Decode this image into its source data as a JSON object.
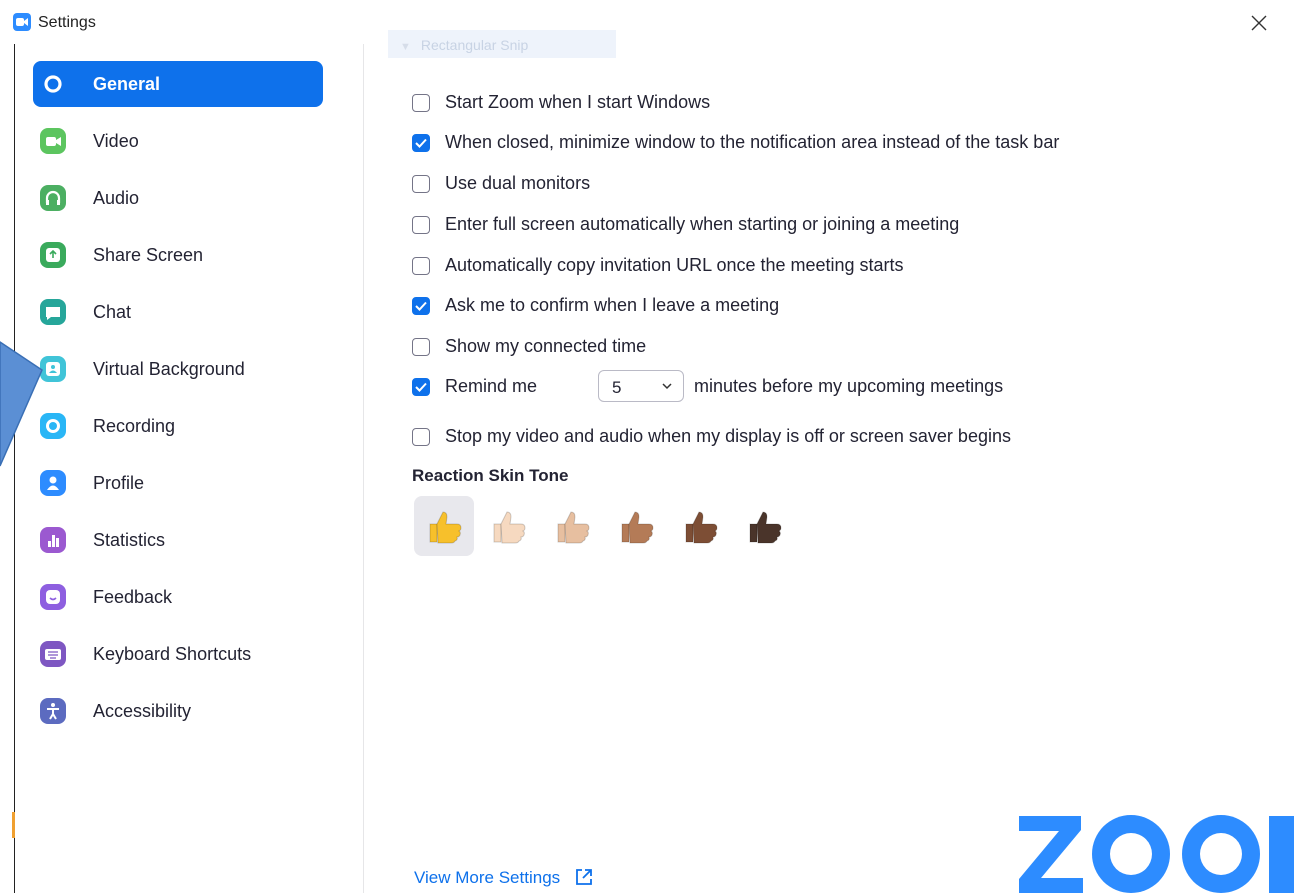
{
  "window": {
    "title": "Settings"
  },
  "overlay": {
    "snip_label": "Rectangular Snip"
  },
  "sidebar": {
    "items": [
      {
        "label": "General",
        "icon": "gear-icon",
        "color": "#0e71eb",
        "active": true
      },
      {
        "label": "Video",
        "icon": "video-camera-icon",
        "color": "#5cc55f"
      },
      {
        "label": "Audio",
        "icon": "headphones-icon",
        "color": "#4caf62"
      },
      {
        "label": "Share Screen",
        "icon": "share-screen-icon",
        "color": "#3aaa5c"
      },
      {
        "label": "Chat",
        "icon": "chat-bubble-icon",
        "color": "#26a69a"
      },
      {
        "label": "Virtual Background",
        "icon": "virtual-background-icon",
        "color": "#40c4d8"
      },
      {
        "label": "Recording",
        "icon": "record-icon",
        "color": "#29b6f6"
      },
      {
        "label": "Profile",
        "icon": "profile-icon",
        "color": "#2d8cff"
      },
      {
        "label": "Statistics",
        "icon": "statistics-icon",
        "color": "#9b59d0"
      },
      {
        "label": "Feedback",
        "icon": "smiley-icon",
        "color": "#8e5fe0"
      },
      {
        "label": "Keyboard Shortcuts",
        "icon": "keyboard-icon",
        "color": "#7e57c2"
      },
      {
        "label": "Accessibility",
        "icon": "accessibility-icon",
        "color": "#5c6bc0"
      }
    ]
  },
  "general": {
    "options": [
      {
        "label": "Start Zoom when I start Windows",
        "checked": false
      },
      {
        "label": "When closed, minimize window to the notification area instead of the task bar",
        "checked": true
      },
      {
        "label": "Use dual monitors",
        "checked": false
      },
      {
        "label": "Enter full screen automatically when starting or joining a meeting",
        "checked": false
      },
      {
        "label": "Automatically copy invitation URL once the meeting starts",
        "checked": false
      },
      {
        "label": "Ask me to confirm when I leave a meeting",
        "checked": true
      },
      {
        "label": "Show my connected time",
        "checked": false
      },
      {
        "label": "Remind me",
        "checked": true,
        "select_value": "5",
        "suffix": "minutes before my upcoming meetings"
      },
      {
        "label": "Stop my video and audio when my display is off or screen saver begins",
        "checked": false
      }
    ],
    "reaction_skin_tone": {
      "title": "Reaction Skin Tone",
      "tones": [
        "#f7c02b",
        "#f6d9c0",
        "#e7bfa0",
        "#b47b57",
        "#7d4e35",
        "#4a342a"
      ],
      "selected_index": 0
    },
    "view_more_label": "View More Settings"
  },
  "brand": {
    "logo_text": "zoom",
    "accent": "#2d8cff"
  }
}
